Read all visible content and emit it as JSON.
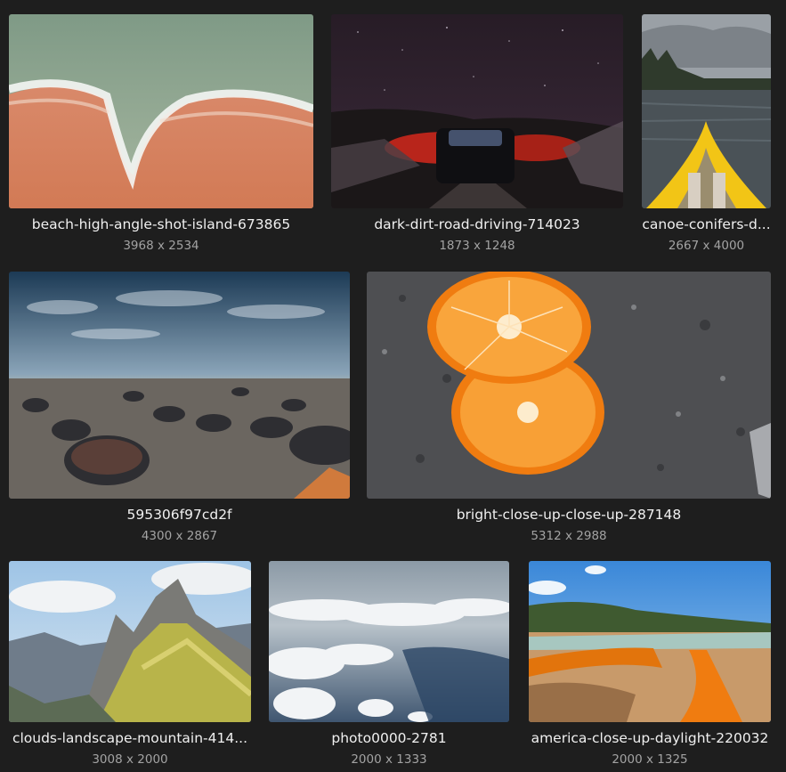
{
  "gallery": {
    "items": [
      {
        "name": "beach-high-angle-shot-island-673865",
        "dims": "3968 x 2534",
        "icon": "beach-waves-aerial-photo"
      },
      {
        "name": "dark-dirt-road-driving-714023",
        "dims": "1873 x 1248",
        "icon": "night-car-photo"
      },
      {
        "name": "canoe-conifers-d...",
        "dims": "2667 x 4000",
        "icon": "canoe-lake-photo"
      },
      {
        "name": "595306f97cd2f",
        "dims": "4300 x 2867",
        "icon": "rocky-beach-sunset-photo"
      },
      {
        "name": "bright-close-up-close-up-287148",
        "dims": "5312 x 2988",
        "icon": "orange-halves-photo"
      },
      {
        "name": "clouds-landscape-mountain-414...",
        "dims": "3008 x 2000",
        "icon": "mountain-landscape-photo"
      },
      {
        "name": "photo0000-2781",
        "dims": "2000 x 1333",
        "icon": "aerial-clouds-photo"
      },
      {
        "name": "america-close-up-daylight-220032",
        "dims": "2000 x 1325",
        "icon": "hot-spring-photo"
      }
    ]
  }
}
